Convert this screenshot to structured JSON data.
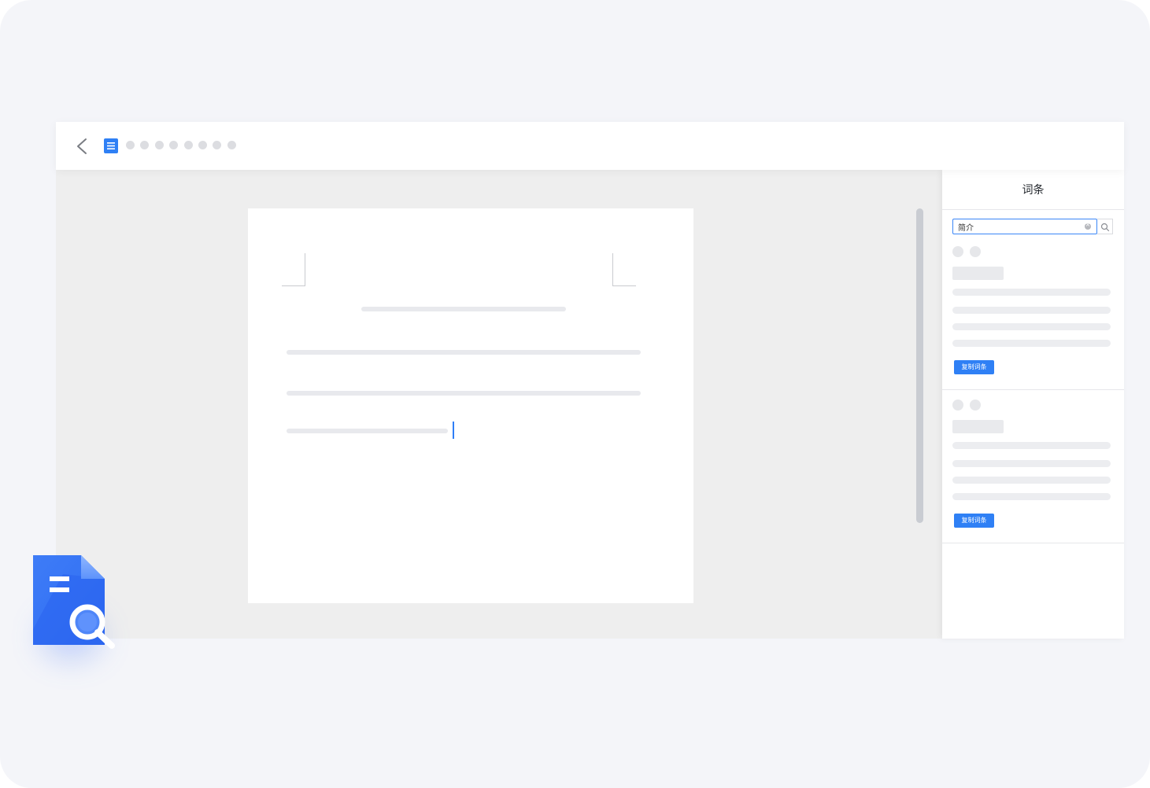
{
  "toolbar": {
    "doc_title_dots_count": 8,
    "back_icon": "chevron-left-icon",
    "doc_icon": "document-icon"
  },
  "colors": {
    "accent": "#2f80f5",
    "canvas_bg": "#f4f5f9",
    "editor_bg": "#eeeeee",
    "placeholder": "#e8e9ed"
  },
  "panel": {
    "title": "词条",
    "search": {
      "value": "简介",
      "placeholder": ""
    },
    "entries": [
      {
        "copy_label": "复制词条"
      },
      {
        "copy_label": "复制词条"
      }
    ]
  },
  "logo": {
    "icon": "document-search-icon"
  }
}
